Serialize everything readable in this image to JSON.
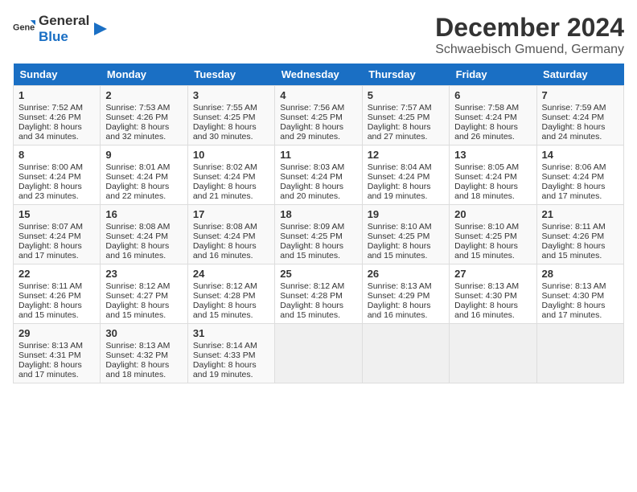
{
  "header": {
    "logo_general": "General",
    "logo_blue": "Blue",
    "title": "December 2024",
    "subtitle": "Schwaebisch Gmuend, Germany"
  },
  "days_of_week": [
    "Sunday",
    "Monday",
    "Tuesday",
    "Wednesday",
    "Thursday",
    "Friday",
    "Saturday"
  ],
  "weeks": [
    [
      {
        "day": "1",
        "sunrise": "7:52 AM",
        "sunset": "4:26 PM",
        "daylight": "8 hours and 34 minutes."
      },
      {
        "day": "2",
        "sunrise": "7:53 AM",
        "sunset": "4:26 PM",
        "daylight": "8 hours and 32 minutes."
      },
      {
        "day": "3",
        "sunrise": "7:55 AM",
        "sunset": "4:25 PM",
        "daylight": "8 hours and 30 minutes."
      },
      {
        "day": "4",
        "sunrise": "7:56 AM",
        "sunset": "4:25 PM",
        "daylight": "8 hours and 29 minutes."
      },
      {
        "day": "5",
        "sunrise": "7:57 AM",
        "sunset": "4:25 PM",
        "daylight": "8 hours and 27 minutes."
      },
      {
        "day": "6",
        "sunrise": "7:58 AM",
        "sunset": "4:24 PM",
        "daylight": "8 hours and 26 minutes."
      },
      {
        "day": "7",
        "sunrise": "7:59 AM",
        "sunset": "4:24 PM",
        "daylight": "8 hours and 24 minutes."
      }
    ],
    [
      {
        "day": "8",
        "sunrise": "8:00 AM",
        "sunset": "4:24 PM",
        "daylight": "8 hours and 23 minutes."
      },
      {
        "day": "9",
        "sunrise": "8:01 AM",
        "sunset": "4:24 PM",
        "daylight": "8 hours and 22 minutes."
      },
      {
        "day": "10",
        "sunrise": "8:02 AM",
        "sunset": "4:24 PM",
        "daylight": "8 hours and 21 minutes."
      },
      {
        "day": "11",
        "sunrise": "8:03 AM",
        "sunset": "4:24 PM",
        "daylight": "8 hours and 20 minutes."
      },
      {
        "day": "12",
        "sunrise": "8:04 AM",
        "sunset": "4:24 PM",
        "daylight": "8 hours and 19 minutes."
      },
      {
        "day": "13",
        "sunrise": "8:05 AM",
        "sunset": "4:24 PM",
        "daylight": "8 hours and 18 minutes."
      },
      {
        "day": "14",
        "sunrise": "8:06 AM",
        "sunset": "4:24 PM",
        "daylight": "8 hours and 17 minutes."
      }
    ],
    [
      {
        "day": "15",
        "sunrise": "8:07 AM",
        "sunset": "4:24 PM",
        "daylight": "8 hours and 17 minutes."
      },
      {
        "day": "16",
        "sunrise": "8:08 AM",
        "sunset": "4:24 PM",
        "daylight": "8 hours and 16 minutes."
      },
      {
        "day": "17",
        "sunrise": "8:08 AM",
        "sunset": "4:24 PM",
        "daylight": "8 hours and 16 minutes."
      },
      {
        "day": "18",
        "sunrise": "8:09 AM",
        "sunset": "4:25 PM",
        "daylight": "8 hours and 15 minutes."
      },
      {
        "day": "19",
        "sunrise": "8:10 AM",
        "sunset": "4:25 PM",
        "daylight": "8 hours and 15 minutes."
      },
      {
        "day": "20",
        "sunrise": "8:10 AM",
        "sunset": "4:25 PM",
        "daylight": "8 hours and 15 minutes."
      },
      {
        "day": "21",
        "sunrise": "8:11 AM",
        "sunset": "4:26 PM",
        "daylight": "8 hours and 15 minutes."
      }
    ],
    [
      {
        "day": "22",
        "sunrise": "8:11 AM",
        "sunset": "4:26 PM",
        "daylight": "8 hours and 15 minutes."
      },
      {
        "day": "23",
        "sunrise": "8:12 AM",
        "sunset": "4:27 PM",
        "daylight": "8 hours and 15 minutes."
      },
      {
        "day": "24",
        "sunrise": "8:12 AM",
        "sunset": "4:28 PM",
        "daylight": "8 hours and 15 minutes."
      },
      {
        "day": "25",
        "sunrise": "8:12 AM",
        "sunset": "4:28 PM",
        "daylight": "8 hours and 15 minutes."
      },
      {
        "day": "26",
        "sunrise": "8:13 AM",
        "sunset": "4:29 PM",
        "daylight": "8 hours and 16 minutes."
      },
      {
        "day": "27",
        "sunrise": "8:13 AM",
        "sunset": "4:30 PM",
        "daylight": "8 hours and 16 minutes."
      },
      {
        "day": "28",
        "sunrise": "8:13 AM",
        "sunset": "4:30 PM",
        "daylight": "8 hours and 17 minutes."
      }
    ],
    [
      {
        "day": "29",
        "sunrise": "8:13 AM",
        "sunset": "4:31 PM",
        "daylight": "8 hours and 17 minutes."
      },
      {
        "day": "30",
        "sunrise": "8:13 AM",
        "sunset": "4:32 PM",
        "daylight": "8 hours and 18 minutes."
      },
      {
        "day": "31",
        "sunrise": "8:14 AM",
        "sunset": "4:33 PM",
        "daylight": "8 hours and 19 minutes."
      },
      null,
      null,
      null,
      null
    ]
  ],
  "labels": {
    "sunrise": "Sunrise:",
    "sunset": "Sunset:",
    "daylight": "Daylight:"
  }
}
